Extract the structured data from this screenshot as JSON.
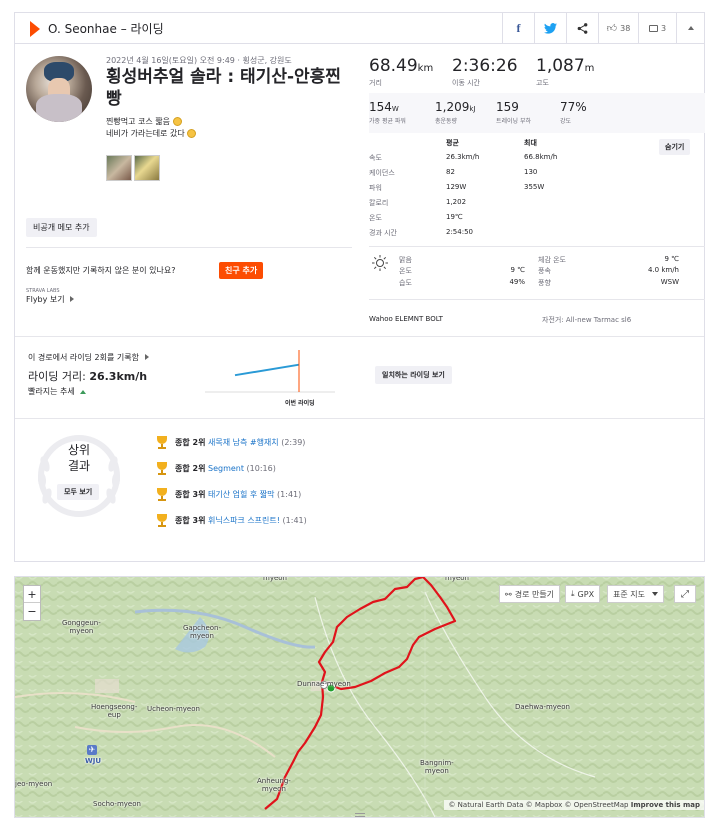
{
  "header": {
    "title": "O. Seonhae – 라이딩",
    "kudos_count": "38",
    "comment_count": "3"
  },
  "activity": {
    "date_location": "2022년 4월 16일(토요일) 오전 9:49 · 횡성군, 강원도",
    "title": "횡성버추얼 솔라 : 태기산-안흥찐빵",
    "description_line1": "찐빵먹고 코스 짧음",
    "description_line2": "네비가 가라는데로 갔다",
    "private_note_button": "비공개 메모 추가",
    "friend_prompt": "함께 운동했지만 기록하지 않은 분이 있나요?",
    "add_friend_button": "친구 추가",
    "flyby_small": "STRAVA LABS",
    "flyby_link": "Flyby 보기"
  },
  "stats": {
    "distance_value": "68.49",
    "distance_unit": "km",
    "distance_label": "거리",
    "moving_time_value": "2:36:26",
    "moving_time_label": "이동 시간",
    "elevation_value": "1,087",
    "elevation_unit": "m",
    "elevation_label": "고도",
    "weighted_power_value": "154",
    "weighted_power_unit": "W",
    "weighted_power_label": "가중 평균 파워",
    "work_value": "1,209",
    "work_unit": "kJ",
    "work_label": "총운동량",
    "training_load_value": "159",
    "training_load_label": "트레이닝 부하",
    "intensity_value": "77%",
    "intensity_label": "강도"
  },
  "details": {
    "col_avg": "평균",
    "col_max": "최대",
    "hide_button": "숨기기",
    "rows": [
      {
        "label": "속도",
        "avg": "26.3km/h",
        "max": "66.8km/h"
      },
      {
        "label": "케이던스",
        "avg": "82",
        "max": "130"
      },
      {
        "label": "파워",
        "avg": "129W",
        "max": "355W"
      },
      {
        "label": "칼로리",
        "avg": "1,202",
        "max": ""
      },
      {
        "label": "온도",
        "avg": "19℃",
        "max": ""
      },
      {
        "label": "경과 시간",
        "avg": "2:54:50",
        "max": ""
      }
    ]
  },
  "weather": {
    "condition": "맑음",
    "temp_label": "온도",
    "temp_value": "9 ℃",
    "humidity_label": "습도",
    "humidity_value": "49%",
    "feels_label": "체감 온도",
    "feels_value": "9 ℃",
    "wind_speed_label": "풍속",
    "wind_speed_value": "4.0 km/h",
    "wind_dir_label": "풍향",
    "wind_dir_value": "WSW"
  },
  "device": {
    "device_name": "Wahoo ELEMNT BOLT",
    "bike_label": "자전거: All-new Tarmac sl6"
  },
  "matched": {
    "line1": "이 경로에서 라이딩 2회를 기록함",
    "speed_label": "라이딩 거리: ",
    "speed_value": "26.3km/h",
    "trend_label": "빨라지는 추세",
    "chart_caption": "이번 라이딩",
    "view_button": "일치하는 라이딩 보기",
    "trend_fraction": [
      0.4,
      0.65
    ]
  },
  "results": {
    "badge_line1": "상위",
    "badge_line2": "결과",
    "view_all": "모두 보기",
    "items": [
      {
        "rank": "종합 2위",
        "name": "새목재 남측 #행재치",
        "time": "(2:39)"
      },
      {
        "rank": "종합 2위",
        "name": "Segment",
        "time": "(10:16)"
      },
      {
        "rank": "종합 3위",
        "name": "태기산 업힐 후 짧막",
        "time": "(1:41)"
      },
      {
        "rank": "종합 3위",
        "name": "휘닉스파크 스프린트!",
        "time": "(1:41)"
      }
    ]
  },
  "map": {
    "zoom_in": "+",
    "zoom_out": "−",
    "create_route": "경로 만들기",
    "gpx": "GPX",
    "map_type": "표준 지도",
    "attribution": "© Natural Earth Data © Mapbox © OpenStreetMap",
    "improve": "Improve this map",
    "places": {
      "gongguen": "Gonggeun-\nmyeon",
      "gapcheon": "Gapcheon-\nmyeon",
      "hoengseong": "Hoengseong-\neup",
      "ucheon": "Ucheon-myeon",
      "dunnae": "Dunnae-myeon",
      "daehwa": "Daehwa-myeon",
      "bangnim": "Bangnim-\nmyeon",
      "anheung": "Anheung-\nmyeon",
      "socho": "Socho-myeon",
      "jeo": "jeo-myeon",
      "wju": "WJU",
      "top_myeon": "myeon",
      "top_left": "myeon"
    }
  },
  "colors": {
    "brand": "#fc4c02",
    "link": "#1a73c8",
    "route": "#e0131b",
    "trend_line": "#2a9ad6"
  }
}
